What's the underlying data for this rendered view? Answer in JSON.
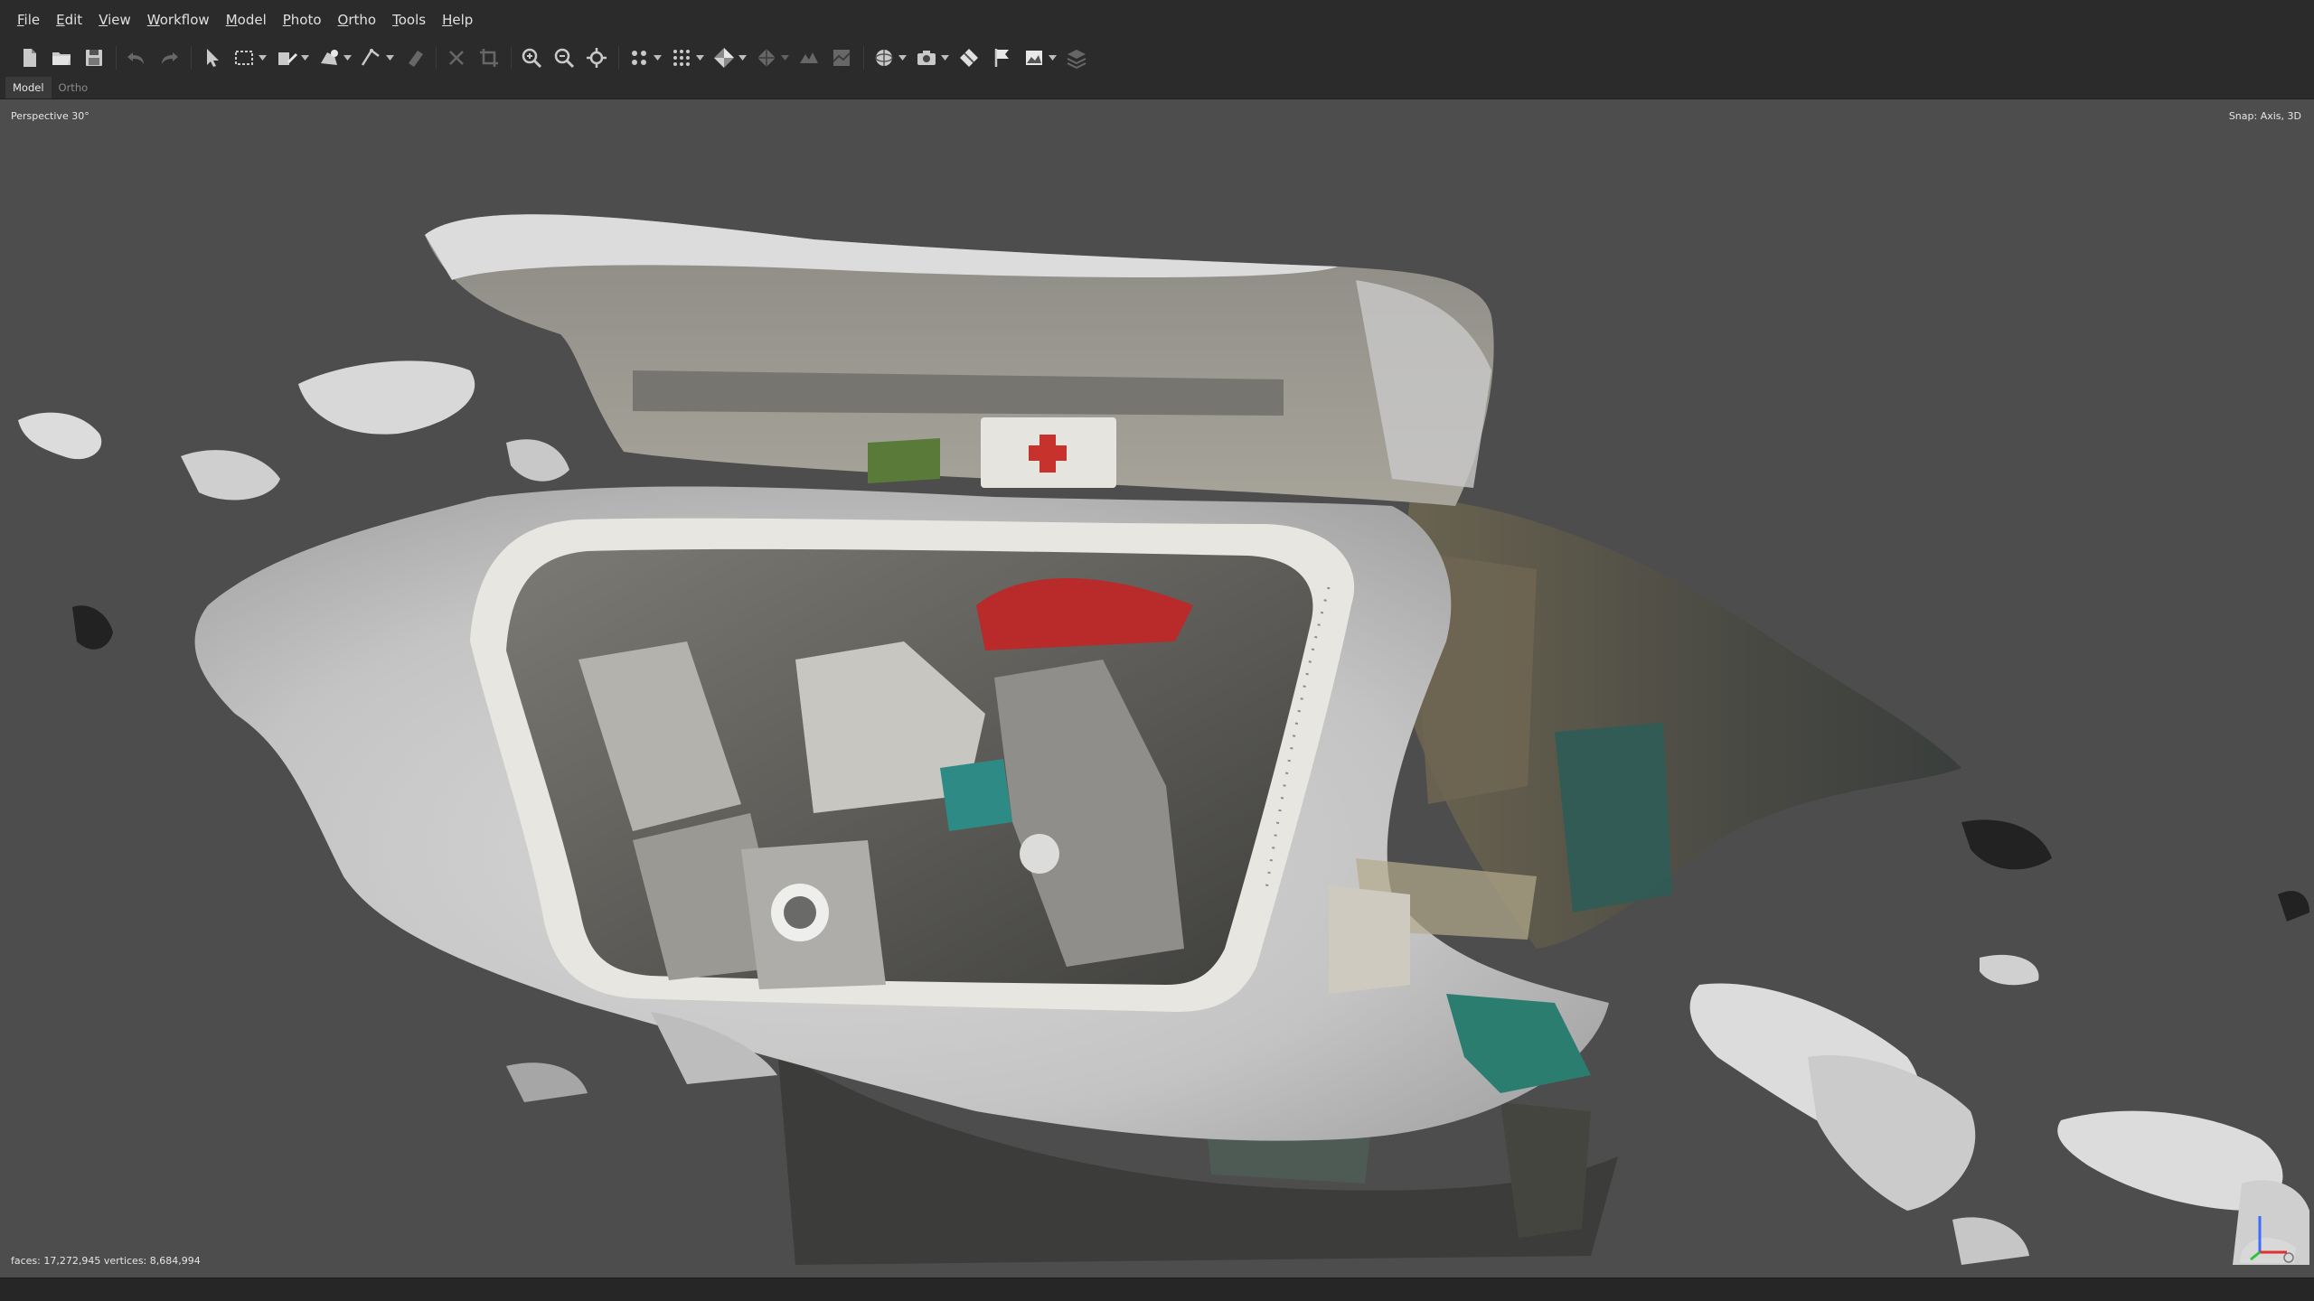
{
  "menu": [
    {
      "key": "file",
      "acc": "F",
      "rest": "ile"
    },
    {
      "key": "edit",
      "acc": "E",
      "rest": "dit"
    },
    {
      "key": "view",
      "acc": "V",
      "rest": "iew"
    },
    {
      "key": "workflow",
      "acc": "W",
      "rest": "orkflow"
    },
    {
      "key": "model",
      "acc": "M",
      "rest": "odel"
    },
    {
      "key": "photo",
      "acc": "P",
      "rest": "hoto"
    },
    {
      "key": "ortho",
      "acc": "O",
      "rest": "rtho"
    },
    {
      "key": "tools",
      "acc": "T",
      "rest": "ools"
    },
    {
      "key": "help",
      "acc": "H",
      "rest": "elp"
    }
  ],
  "tabs": {
    "model": "Model",
    "ortho": "Ortho"
  },
  "viewport": {
    "projection": "Perspective 30°",
    "snap": "Snap: Axis, 3D",
    "stats": "faces: 17,272,945 vertices: 8,684,994"
  },
  "toolbar": [
    {
      "icon": "new-document-icon",
      "dropdown": false,
      "disabled": false
    },
    {
      "icon": "open-folder-icon",
      "dropdown": false,
      "disabled": false
    },
    {
      "icon": "save-icon",
      "dropdown": false,
      "disabled": false
    },
    {
      "sep": true
    },
    {
      "icon": "undo-icon",
      "dropdown": false,
      "disabled": true
    },
    {
      "icon": "redo-icon",
      "dropdown": false,
      "disabled": true
    },
    {
      "sep": true
    },
    {
      "icon": "navigation-cursor-icon",
      "dropdown": false,
      "disabled": false
    },
    {
      "icon": "rectangle-selection-icon",
      "dropdown": true,
      "disabled": false
    },
    {
      "icon": "draw-polygon-icon",
      "dropdown": true,
      "disabled": false
    },
    {
      "icon": "region-shapes-icon",
      "dropdown": true,
      "disabled": false
    },
    {
      "icon": "ruler-icon",
      "dropdown": true,
      "disabled": false
    },
    {
      "icon": "eraser-icon",
      "dropdown": false,
      "disabled": true
    },
    {
      "sep": true
    },
    {
      "icon": "delete-selection-icon",
      "dropdown": false,
      "disabled": true
    },
    {
      "icon": "crop-selection-icon",
      "dropdown": false,
      "disabled": true
    },
    {
      "sep": true
    },
    {
      "icon": "zoom-in-icon",
      "dropdown": false,
      "disabled": false
    },
    {
      "icon": "zoom-out-icon",
      "dropdown": false,
      "disabled": false
    },
    {
      "icon": "reset-view-icon",
      "dropdown": false,
      "disabled": false
    },
    {
      "sep": true
    },
    {
      "icon": "point-cloud-icon",
      "dropdown": true,
      "disabled": false
    },
    {
      "icon": "dense-cloud-icon",
      "dropdown": true,
      "disabled": false
    },
    {
      "icon": "model-shaded-icon",
      "dropdown": true,
      "disabled": false
    },
    {
      "icon": "tiled-model-icon",
      "dropdown": true,
      "disabled": true
    },
    {
      "icon": "dem-icon",
      "dropdown": false,
      "disabled": true
    },
    {
      "icon": "orthomosaic-icon",
      "dropdown": false,
      "disabled": true
    },
    {
      "sep": true
    },
    {
      "icon": "region-sphere-icon",
      "dropdown": true,
      "disabled": false
    },
    {
      "icon": "camera-icon",
      "dropdown": true,
      "disabled": false
    },
    {
      "icon": "shapes-icon",
      "dropdown": false,
      "disabled": false
    },
    {
      "icon": "markers-flag-icon",
      "dropdown": false,
      "disabled": false
    },
    {
      "icon": "image-toggle-icon",
      "dropdown": true,
      "disabled": false
    },
    {
      "icon": "layers-icon",
      "dropdown": false,
      "disabled": true
    }
  ],
  "colors": {
    "menubar_bg": "#2b2b2b",
    "viewport_bg": "#4d4d4d",
    "axis_x": "#e03030",
    "axis_y": "#30c040",
    "axis_z": "#3a6cff"
  }
}
